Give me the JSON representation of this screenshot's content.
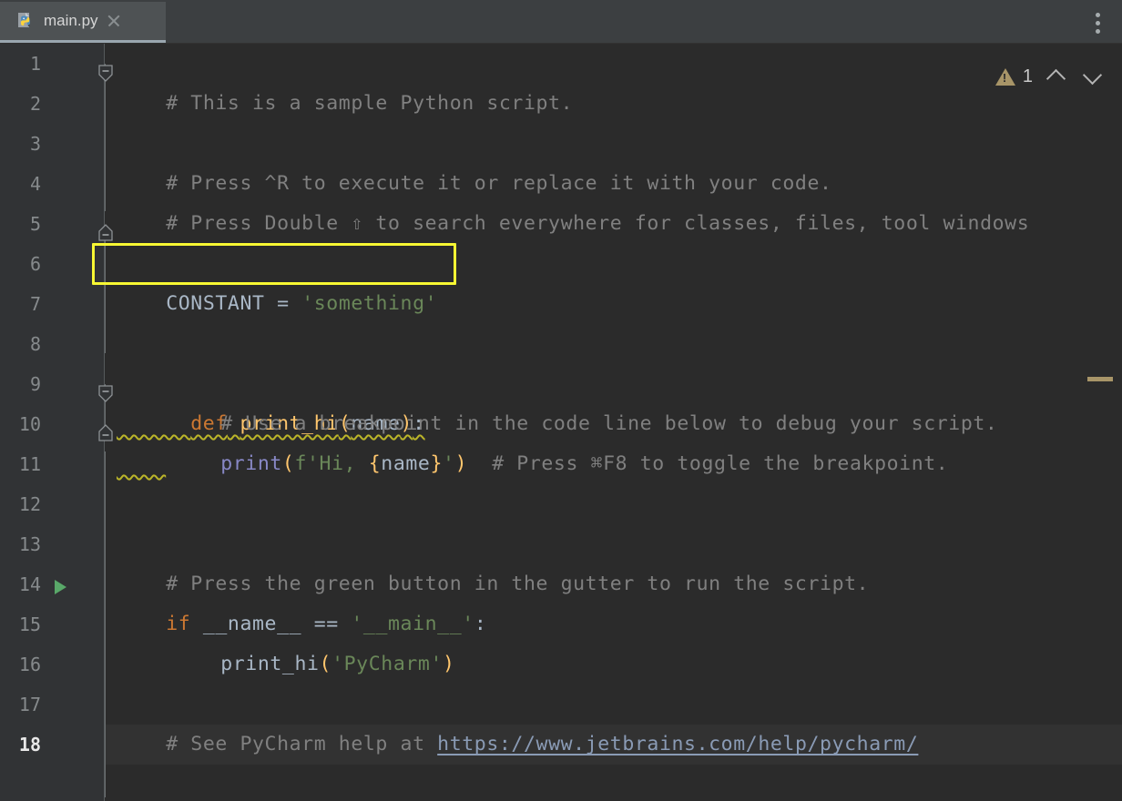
{
  "tab": {
    "filename": "main.py",
    "icon": "python-file-icon",
    "close_icon": "close-icon"
  },
  "toolbar": {
    "more_icon": "kebab-menu-icon"
  },
  "inspections": {
    "warning_icon": "warning-triangle-icon",
    "count": "1",
    "prev_icon": "chevron-up-icon",
    "next_icon": "chevron-down-icon"
  },
  "editor": {
    "current_line": 18,
    "highlight_color": "#f7f733",
    "background": "#2b2b2b",
    "gutter_background": "#313335",
    "lines": [
      {
        "n": "1",
        "text": "# This is a sample Python script."
      },
      {
        "n": "2",
        "text": ""
      },
      {
        "n": "3",
        "text": "# Press ^R to execute it or replace it with your code."
      },
      {
        "n": "4",
        "text": "# Press Double ⇧ to search everywhere for classes, files, tool windows"
      },
      {
        "n": "5",
        "text": ""
      },
      {
        "n": "6",
        "text": "CONSTANT = 'something'"
      },
      {
        "n": "7",
        "text": ""
      },
      {
        "n": "8",
        "text": "def print_hi(name):"
      },
      {
        "n": "9",
        "text": "    # Use a breakpoint in the code line below to debug your script."
      },
      {
        "n": "10",
        "text": "    print(f'Hi, {name}')  # Press ⌘F8 to toggle the breakpoint."
      },
      {
        "n": "11",
        "text": ""
      },
      {
        "n": "12",
        "text": ""
      },
      {
        "n": "13",
        "text": "# Press the green button in the gutter to run the script."
      },
      {
        "n": "14",
        "text": "if __name__ == '__main__':"
      },
      {
        "n": "15",
        "text": "    print_hi('PyCharm')"
      },
      {
        "n": "16",
        "text": ""
      },
      {
        "n": "17",
        "text": "# See PyCharm help at https://www.jetbrains.com/help/pycharm/"
      },
      {
        "n": "18",
        "text": ""
      }
    ],
    "tokens": {
      "l1_comment": "# This is a sample Python script.",
      "l3_comment": "# Press ^R to execute it or replace it with your code.",
      "l4_comment": "# Press Double ⇧ to search everywhere for classes, files, tool windows",
      "l6_name": "CONSTANT",
      "l6_eq": " = ",
      "l6_string": "'something'",
      "l8_def": "def",
      "l8_space": " ",
      "l8_funcname": "print_hi",
      "l8_paren_open": "(",
      "l8_param": "name",
      "l8_paren_close": ")",
      "l8_colon": ":",
      "l9_comment": "# Use a breakpoint in the code line below to debug your script.",
      "l10_print": "print",
      "l10_paren_open": "(",
      "l10_fstr_a": "f'Hi, ",
      "l10_brace_open": "{",
      "l10_var": "name",
      "l10_brace_close": "}",
      "l10_fstr_b": "'",
      "l10_paren_close": ")",
      "l10_comment": "  # Press ⌘F8 to toggle the breakpoint.",
      "l13_comment": "# Press the green button in the gutter to run the script.",
      "l14_if": "if",
      "l14_name": " __name__ ",
      "l14_eq": "== ",
      "l14_main": "'__main__'",
      "l14_colon": ":",
      "l15_call": "print_hi",
      "l15_paren_open": "(",
      "l15_arg": "'PyCharm'",
      "l15_paren_close": ")",
      "l17_comment": "# See PyCharm help at ",
      "l17_url": "https://www.jetbrains.com/help/pycharm/"
    },
    "gutter_icons": {
      "fold_line1": "fold-collapse-icon",
      "fold_line4": "fold-collapse-end-icon",
      "fold_line8": "fold-collapse-icon",
      "fold_line10": "fold-collapse-end-icon",
      "run_line14": "run-script-icon"
    }
  }
}
